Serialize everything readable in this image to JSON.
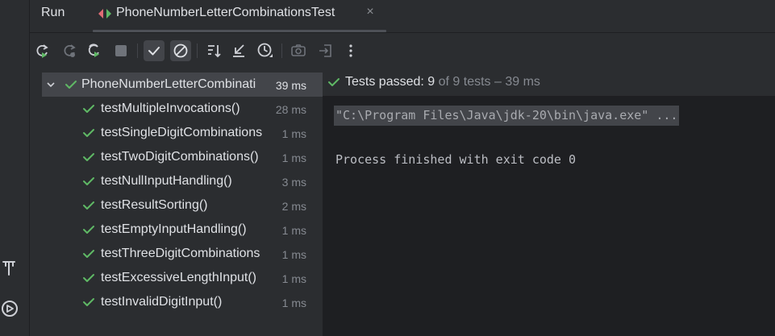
{
  "window": {
    "panel_title": "Run",
    "tab": {
      "label": "PhoneNumberLetterCombinationsTest",
      "icon": "test-run-icon",
      "close_glyph": "×"
    }
  },
  "toolbar": {
    "buttons": [
      {
        "name": "rerun-icon"
      },
      {
        "name": "rerun-failed-icon"
      },
      {
        "name": "toggle-auto-test-icon"
      },
      {
        "name": "stop-icon"
      },
      {
        "name": "show-passed-icon",
        "active": true
      },
      {
        "name": "show-ignored-icon",
        "active": true
      },
      {
        "name": "sort-alphabetically-icon"
      },
      {
        "name": "collapse-all-icon"
      },
      {
        "name": "sort-by-duration-icon"
      },
      {
        "name": "screenshot-icon"
      },
      {
        "name": "export-results-icon"
      },
      {
        "name": "more-options-icon"
      }
    ]
  },
  "tree": {
    "root": {
      "label": "PhoneNumberLetterCombinati",
      "time": "39 ms",
      "status": "passed"
    },
    "tests": [
      {
        "label": "testMultipleInvocations()",
        "time": "28 ms"
      },
      {
        "label": "testSingleDigitCombinations",
        "time": "1 ms"
      },
      {
        "label": "testTwoDigitCombinations()",
        "time": "1 ms"
      },
      {
        "label": "testNullInputHandling()",
        "time": "3 ms"
      },
      {
        "label": "testResultSorting()",
        "time": "2 ms"
      },
      {
        "label": "testEmptyInputHandling()",
        "time": "1 ms"
      },
      {
        "label": "testThreeDigitCombinations",
        "time": "1 ms"
      },
      {
        "label": "testExcessiveLengthInput()",
        "time": "1 ms"
      },
      {
        "label": "testInvalidDigitInput()",
        "time": "1 ms"
      }
    ]
  },
  "status": {
    "prefix": "Tests passed: ",
    "passed": "9",
    "suffix": " of 9 tests – 39 ms"
  },
  "console": {
    "command": "\"C:\\Program Files\\Java\\jdk-20\\bin\\java.exe\" ...",
    "result": "Process finished with exit code 0"
  },
  "colors": {
    "background": "#2b2d30",
    "console_bg": "#1e1f22",
    "success_green": "#5fb865",
    "selection": "#43454a"
  },
  "left_strip": {
    "icons": [
      "build-hammer-icon",
      "services-icon"
    ]
  }
}
